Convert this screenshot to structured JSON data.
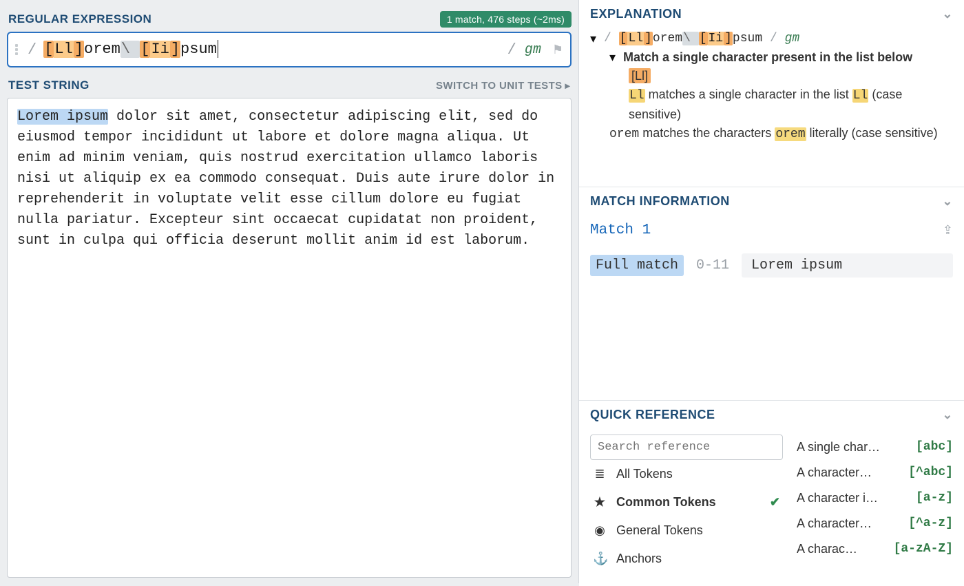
{
  "regex_panel": {
    "title": "REGULAR EXPRESSION",
    "stats": "1 match, 476 steps (~2ms)",
    "delim_open": "/",
    "delim_close": "/",
    "flags": "gm",
    "pattern": {
      "br1_open": "[",
      "set1": "Ll",
      "br1_close": "]",
      "lit1": "orem",
      "esc": "\\ ",
      "br2_open": "[",
      "set2": "Ii",
      "br2_close": "]",
      "lit2": "psum"
    }
  },
  "test_panel": {
    "title": "TEST STRING",
    "switch_label": "SWITCH TO UNIT TESTS",
    "match_text": "Lorem ipsum",
    "rest_text": " dolor sit amet, consectetur adipiscing elit, sed do eiusmod tempor incididunt ut labore et dolore magna aliqua. Ut enim ad minim veniam, quis nostrud exercitation ullamco laboris nisi ut aliquip ex ea commodo consequat. Duis aute irure dolor in reprehenderit in voluptate velit esse cillum dolore eu fugiat nulla pariatur. Excepteur sint occaecat cupidatat non proident, sunt in culpa qui officia deserunt mollit anim id est laborum."
  },
  "explanation": {
    "title": "EXPLANATION",
    "regex_echo": {
      "delim_open": "/",
      "br1_open": "[",
      "set1": "Ll",
      "br1_close": "]",
      "lit1": "orem",
      "esc": "\\ ",
      "br2_open": "[",
      "set2": "Ii",
      "br2_close": "]",
      "lit2": "psum",
      "delim_close": "/",
      "flags": "gm"
    },
    "line_match_single": "Match a single character present in the list below",
    "char_class_token": "[Ll]",
    "ll_token": "Ll",
    "ll_expl_a": " matches a single character in the list ",
    "ll_expl_b": " (case sensitive)",
    "orem_token": "orem",
    "orem_expl_a": " matches the characters ",
    "orem_expl_b": " literally (case sensitive)"
  },
  "match_info": {
    "title": "MATCH INFORMATION",
    "match_label": "Match 1",
    "full_match_label": "Full match",
    "range": "0-11",
    "value": "Lorem ipsum"
  },
  "quick_ref": {
    "title": "QUICK REFERENCE",
    "search_placeholder": "Search reference",
    "cats": {
      "all": "All Tokens",
      "common": "Common Tokens",
      "general": "General Tokens",
      "anchors": "Anchors"
    },
    "items": [
      {
        "label": "A single char…",
        "patt": "[abc]"
      },
      {
        "label": "A character…",
        "patt": "[^abc]"
      },
      {
        "label": "A character i…",
        "patt": "[a-z]"
      },
      {
        "label": "A character…",
        "patt": "[^a-z]"
      },
      {
        "label": "A charac…",
        "patt": "[a-zA-Z]"
      }
    ]
  }
}
